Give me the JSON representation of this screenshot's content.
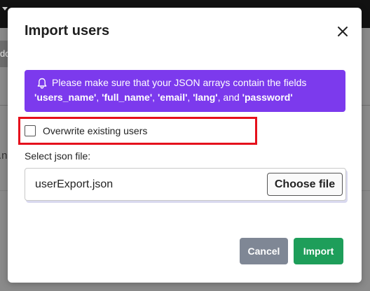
{
  "background": {
    "button_text": "dd",
    "right_header_text": "y",
    "left_row_text": ".n"
  },
  "modal": {
    "title": "Import users",
    "close_icon": "close-icon",
    "alert": {
      "icon": "bell-icon",
      "text_before": "Please make sure that your JSON arrays contain the fields",
      "fields": [
        "'users_name'",
        "'full_name'",
        "'email'",
        "'lang'",
        "'password'"
      ],
      "sep": ", ",
      "and": ", and ",
      "color": "#7c3aed"
    },
    "overwrite": {
      "label": "Overwrite existing users",
      "checked": false
    },
    "file": {
      "label": "Select json file:",
      "value": "userExport.json",
      "choose_label": "Choose file"
    },
    "buttons": {
      "cancel": "Cancel",
      "import": "Import",
      "cancel_color": "#7f8795",
      "import_color": "#1e9e5a"
    }
  }
}
